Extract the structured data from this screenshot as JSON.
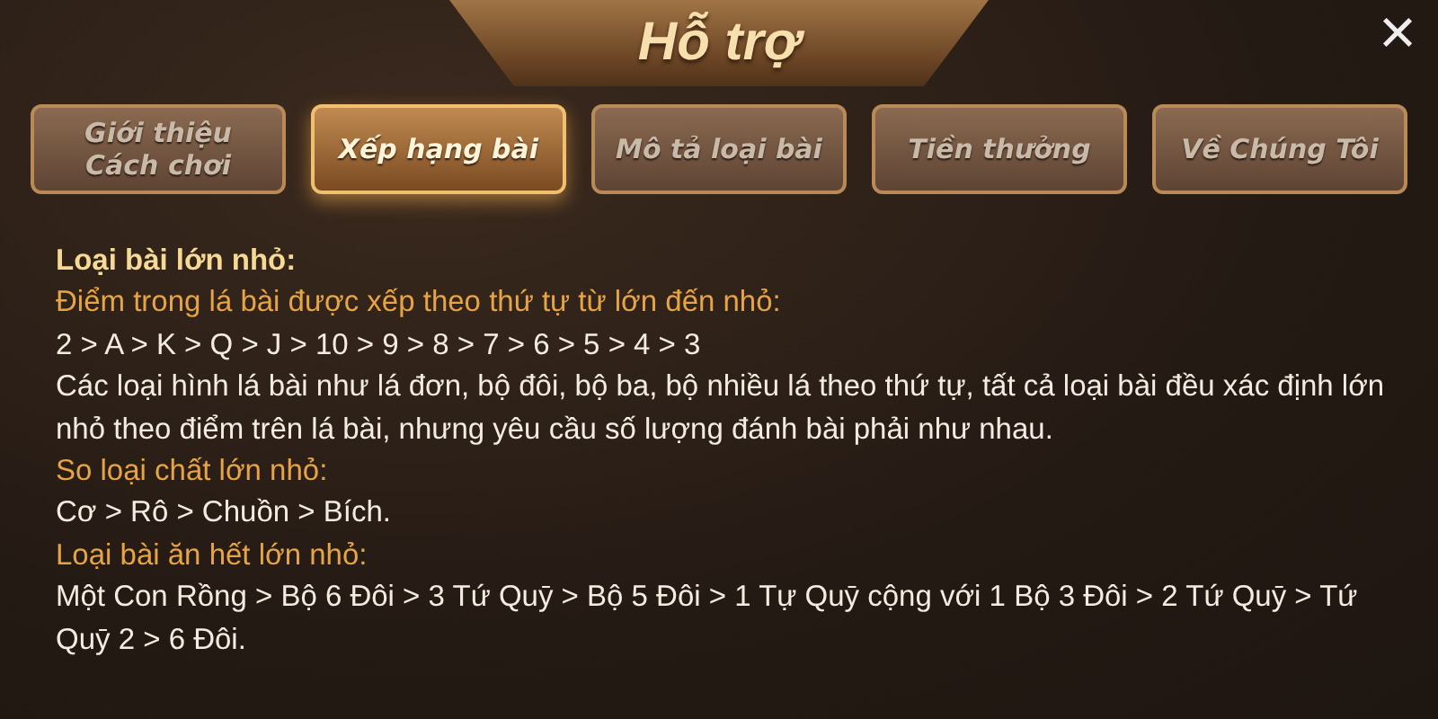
{
  "window": {
    "title": "Hỗ trợ",
    "close": "×"
  },
  "tabs": [
    {
      "label": "Giới thiệu\nCách chơi",
      "selected": false
    },
    {
      "label": "Xếp hạng bài",
      "selected": true
    },
    {
      "label": "Mô tả loại bài",
      "selected": false
    },
    {
      "label": "Tiền thưởng",
      "selected": false
    },
    {
      "label": "Về Chúng Tôi",
      "selected": false
    }
  ],
  "content": [
    {
      "kind": "heading",
      "text": "Loại bài lớn nhỏ:"
    },
    {
      "kind": "subheading",
      "text": "Điểm trong lá bài được xếp theo thứ tự từ lớn đến nhỏ:"
    },
    {
      "kind": "body",
      "text": "2 > A > K > Q > J > 10 > 9 > 8 > 7 > 6 > 5 > 4 > 3"
    },
    {
      "kind": "body",
      "text": "Các loại hình lá bài như lá đơn, bộ đôi, bộ ba, bộ nhiều lá theo thứ tự, tất cả loại bài đều xác định lớn nhỏ theo điểm trên lá bài, nhưng yêu cầu số lượng đánh bài phải như nhau."
    },
    {
      "kind": "subheading",
      "text": "So loại chất lớn nhỏ:"
    },
    {
      "kind": "body",
      "text": "Cơ > Rô > Chuồn > Bích."
    },
    {
      "kind": "subheading",
      "text": "Loại bài ăn hết lớn nhỏ:"
    },
    {
      "kind": "body",
      "text": "Một Con Rồng > Bộ 6 Đôi > 3 Tứ Quȳ > Bộ 5 Đôi > 1 Tự Quȳ cộng với 1 Bộ 3 Đôi > 2 Tứ Quȳ > Tứ Quȳ 2 > 6 Đôi."
    }
  ]
}
